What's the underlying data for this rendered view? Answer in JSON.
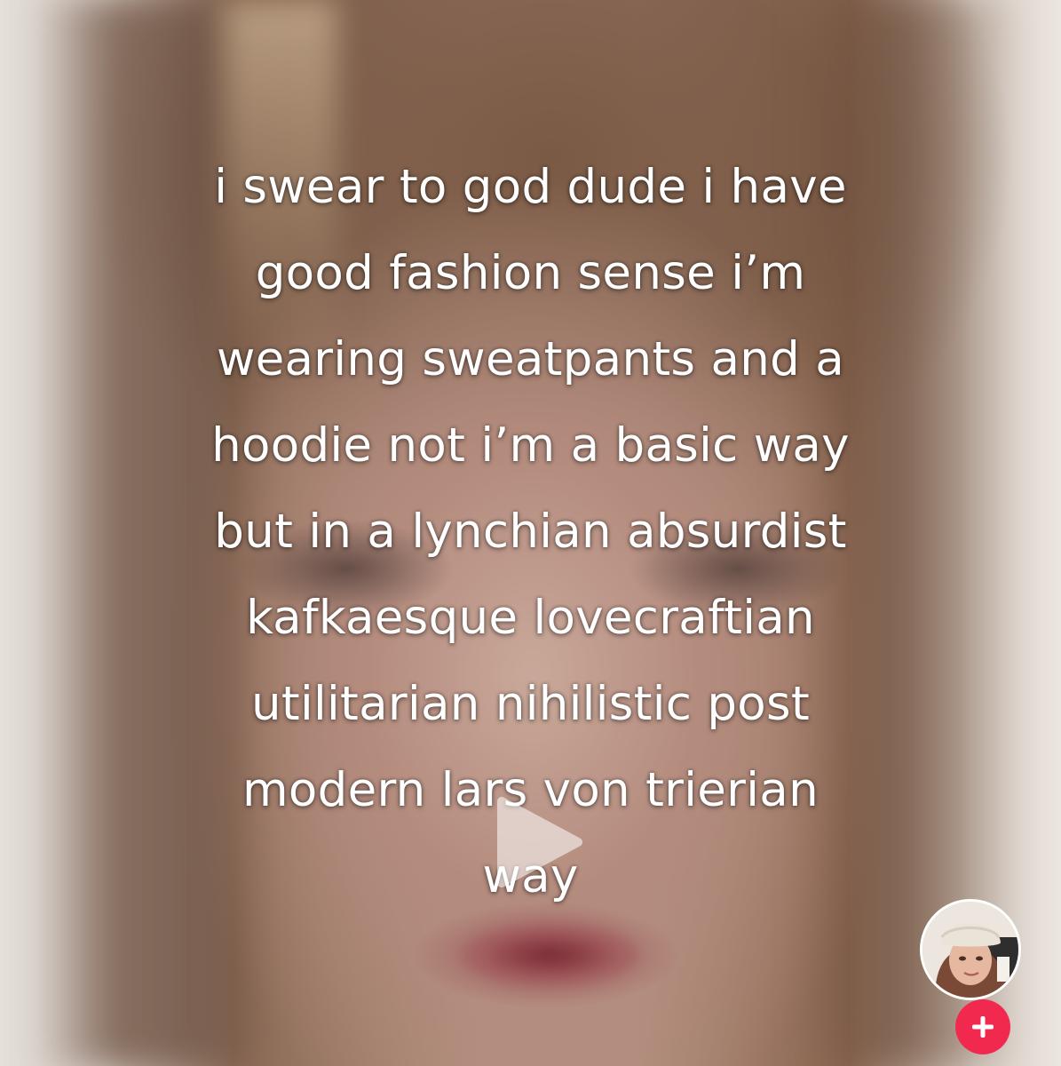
{
  "caption": {
    "lines": [
      "i swear to god dude i have",
      "good fashion sense i’m",
      "wearing sweatpants and a",
      "hoodie not i’m a basic way",
      "but in a lynchian absurdist",
      "kafkaesque lovecraftian",
      "utilitarian nihilistic post",
      "modern lars von trierian",
      "way"
    ]
  },
  "player": {
    "icon": "play-icon"
  },
  "profile": {
    "avatar_icon": "avatar",
    "follow_icon": "plus-icon",
    "follow_color": "#f1294f"
  }
}
